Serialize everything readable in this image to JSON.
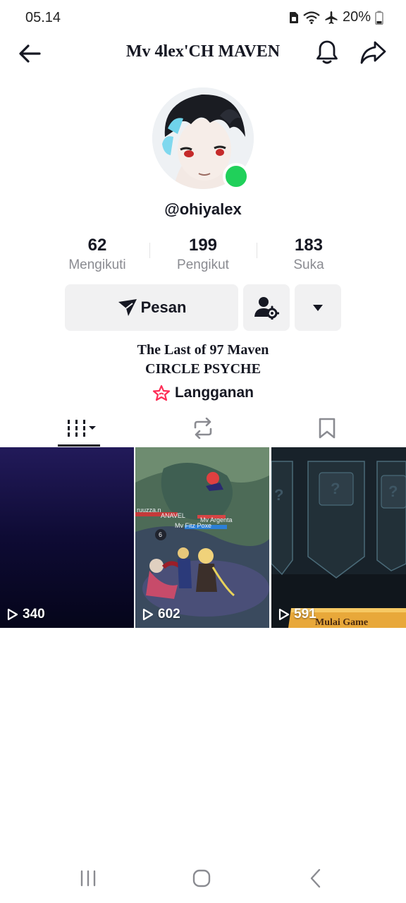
{
  "status_bar": {
    "time": "05.14",
    "battery": "20%"
  },
  "nav": {
    "title": "Mv 4lex'CH MAVEN"
  },
  "profile": {
    "username": "@ohiyalex",
    "online": true,
    "stats": [
      {
        "value": "62",
        "label": "Mengikuti"
      },
      {
        "value": "199",
        "label": "Pengikut"
      },
      {
        "value": "183",
        "label": "Suka"
      }
    ],
    "message_button": "Pesan",
    "bio_lines": [
      "The Last of 97 Maven",
      "CIRCLE PSYCHE"
    ],
    "subscription_label": "Langganan"
  },
  "tabs": [
    "videos-icon",
    "repost-icon",
    "bookmark-icon"
  ],
  "videos": [
    {
      "views": "340"
    },
    {
      "views": "602",
      "overlay_texts": [
        "ruuzza.n",
        "ANAVEL",
        "Mv Argenta",
        "Mv Fitz Poxe",
        "6"
      ]
    },
    {
      "views": "591",
      "banner": "Mulai Game"
    }
  ],
  "colors": {
    "online": "#20d05a",
    "accent_pink": "#fe2c55",
    "button_bg": "#f1f1f2"
  }
}
